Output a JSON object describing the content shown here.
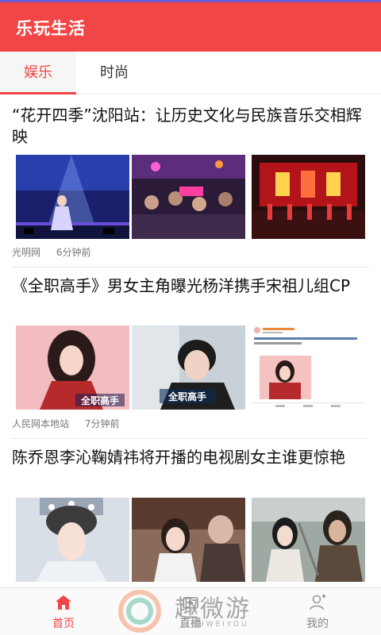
{
  "app": {
    "title": "乐玩生活"
  },
  "tabs": [
    {
      "label": "娱乐",
      "active": true
    },
    {
      "label": "时尚",
      "active": false
    }
  ],
  "articles": [
    {
      "title": "“花开四季”沈阳站：让历史文化与民族音乐交相辉映",
      "source": "光明网",
      "time": "6分钟前",
      "images": [
        "stage-singer-photo",
        "concert-crowd-photo",
        "stage-dancers-photo"
      ]
    },
    {
      "title": "《全职高手》男女主角曝光杨洋携手宋祖儿组CP",
      "source": "人民网本地站",
      "time": "7分钟前",
      "images": [
        "actress-poster-photo",
        "actor-poster-photo",
        "weibo-post-screenshot"
      ],
      "poster_text": "全职高手"
    },
    {
      "title": "陈乔恩李沁鞠婧祎将开播的电视剧女主谁更惊艳",
      "source": "",
      "time": "",
      "images": [
        "costume-actress-photo",
        "drama-still-photo",
        "swordsman-still-photo"
      ]
    }
  ],
  "bottom_nav": [
    {
      "label": "首页",
      "icon": "home-icon",
      "active": true
    },
    {
      "label": "直播",
      "icon": "live-icon",
      "active": false
    },
    {
      "label": "我的",
      "icon": "profile-icon",
      "active": false
    }
  ],
  "watermark": {
    "text": "趣微游",
    "sub": "QUWEIYOU"
  },
  "colors": {
    "accent": "#f24646",
    "status_line": "#6a5acd"
  }
}
